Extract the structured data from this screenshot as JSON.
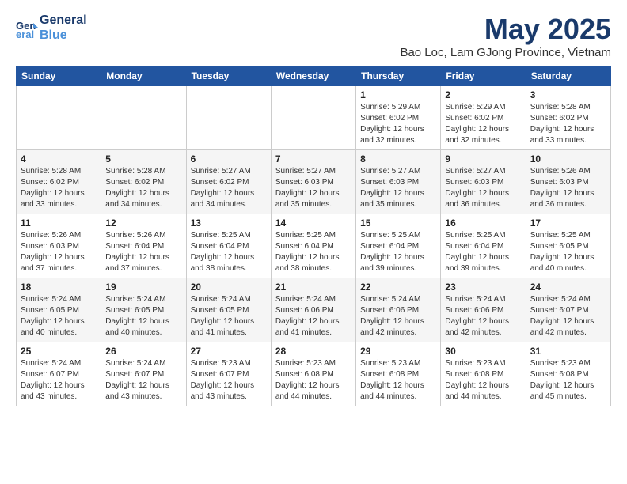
{
  "header": {
    "logo_line1": "General",
    "logo_line2": "Blue",
    "title": "May 2025",
    "subtitle": "Bao Loc, Lam GJong Province, Vietnam"
  },
  "weekdays": [
    "Sunday",
    "Monday",
    "Tuesday",
    "Wednesday",
    "Thursday",
    "Friday",
    "Saturday"
  ],
  "weeks": [
    [
      {
        "day": "",
        "info": ""
      },
      {
        "day": "",
        "info": ""
      },
      {
        "day": "",
        "info": ""
      },
      {
        "day": "",
        "info": ""
      },
      {
        "day": "1",
        "info": "Sunrise: 5:29 AM\nSunset: 6:02 PM\nDaylight: 12 hours\nand 32 minutes."
      },
      {
        "day": "2",
        "info": "Sunrise: 5:29 AM\nSunset: 6:02 PM\nDaylight: 12 hours\nand 32 minutes."
      },
      {
        "day": "3",
        "info": "Sunrise: 5:28 AM\nSunset: 6:02 PM\nDaylight: 12 hours\nand 33 minutes."
      }
    ],
    [
      {
        "day": "4",
        "info": "Sunrise: 5:28 AM\nSunset: 6:02 PM\nDaylight: 12 hours\nand 33 minutes."
      },
      {
        "day": "5",
        "info": "Sunrise: 5:28 AM\nSunset: 6:02 PM\nDaylight: 12 hours\nand 34 minutes."
      },
      {
        "day": "6",
        "info": "Sunrise: 5:27 AM\nSunset: 6:02 PM\nDaylight: 12 hours\nand 34 minutes."
      },
      {
        "day": "7",
        "info": "Sunrise: 5:27 AM\nSunset: 6:03 PM\nDaylight: 12 hours\nand 35 minutes."
      },
      {
        "day": "8",
        "info": "Sunrise: 5:27 AM\nSunset: 6:03 PM\nDaylight: 12 hours\nand 35 minutes."
      },
      {
        "day": "9",
        "info": "Sunrise: 5:27 AM\nSunset: 6:03 PM\nDaylight: 12 hours\nand 36 minutes."
      },
      {
        "day": "10",
        "info": "Sunrise: 5:26 AM\nSunset: 6:03 PM\nDaylight: 12 hours\nand 36 minutes."
      }
    ],
    [
      {
        "day": "11",
        "info": "Sunrise: 5:26 AM\nSunset: 6:03 PM\nDaylight: 12 hours\nand 37 minutes."
      },
      {
        "day": "12",
        "info": "Sunrise: 5:26 AM\nSunset: 6:04 PM\nDaylight: 12 hours\nand 37 minutes."
      },
      {
        "day": "13",
        "info": "Sunrise: 5:25 AM\nSunset: 6:04 PM\nDaylight: 12 hours\nand 38 minutes."
      },
      {
        "day": "14",
        "info": "Sunrise: 5:25 AM\nSunset: 6:04 PM\nDaylight: 12 hours\nand 38 minutes."
      },
      {
        "day": "15",
        "info": "Sunrise: 5:25 AM\nSunset: 6:04 PM\nDaylight: 12 hours\nand 39 minutes."
      },
      {
        "day": "16",
        "info": "Sunrise: 5:25 AM\nSunset: 6:04 PM\nDaylight: 12 hours\nand 39 minutes."
      },
      {
        "day": "17",
        "info": "Sunrise: 5:25 AM\nSunset: 6:05 PM\nDaylight: 12 hours\nand 40 minutes."
      }
    ],
    [
      {
        "day": "18",
        "info": "Sunrise: 5:24 AM\nSunset: 6:05 PM\nDaylight: 12 hours\nand 40 minutes."
      },
      {
        "day": "19",
        "info": "Sunrise: 5:24 AM\nSunset: 6:05 PM\nDaylight: 12 hours\nand 40 minutes."
      },
      {
        "day": "20",
        "info": "Sunrise: 5:24 AM\nSunset: 6:05 PM\nDaylight: 12 hours\nand 41 minutes."
      },
      {
        "day": "21",
        "info": "Sunrise: 5:24 AM\nSunset: 6:06 PM\nDaylight: 12 hours\nand 41 minutes."
      },
      {
        "day": "22",
        "info": "Sunrise: 5:24 AM\nSunset: 6:06 PM\nDaylight: 12 hours\nand 42 minutes."
      },
      {
        "day": "23",
        "info": "Sunrise: 5:24 AM\nSunset: 6:06 PM\nDaylight: 12 hours\nand 42 minutes."
      },
      {
        "day": "24",
        "info": "Sunrise: 5:24 AM\nSunset: 6:07 PM\nDaylight: 12 hours\nand 42 minutes."
      }
    ],
    [
      {
        "day": "25",
        "info": "Sunrise: 5:24 AM\nSunset: 6:07 PM\nDaylight: 12 hours\nand 43 minutes."
      },
      {
        "day": "26",
        "info": "Sunrise: 5:24 AM\nSunset: 6:07 PM\nDaylight: 12 hours\nand 43 minutes."
      },
      {
        "day": "27",
        "info": "Sunrise: 5:23 AM\nSunset: 6:07 PM\nDaylight: 12 hours\nand 43 minutes."
      },
      {
        "day": "28",
        "info": "Sunrise: 5:23 AM\nSunset: 6:08 PM\nDaylight: 12 hours\nand 44 minutes."
      },
      {
        "day": "29",
        "info": "Sunrise: 5:23 AM\nSunset: 6:08 PM\nDaylight: 12 hours\nand 44 minutes."
      },
      {
        "day": "30",
        "info": "Sunrise: 5:23 AM\nSunset: 6:08 PM\nDaylight: 12 hours\nand 44 minutes."
      },
      {
        "day": "31",
        "info": "Sunrise: 5:23 AM\nSunset: 6:08 PM\nDaylight: 12 hours\nand 45 minutes."
      }
    ]
  ]
}
